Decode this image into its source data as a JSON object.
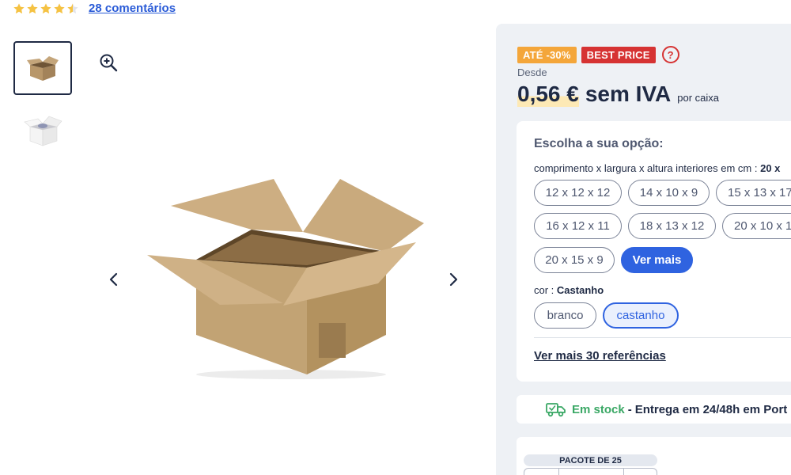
{
  "rating": {
    "stars": 4.5,
    "comments_link": "28 comentários",
    "star_color": "#f5c243"
  },
  "gallery": {
    "thumbnails": [
      "box-thumbnail",
      "white-box-thumbnail"
    ],
    "active_index": 0
  },
  "badges": {
    "discount": "ATÉ -30%",
    "best_price": "BEST PRICE",
    "help": "?"
  },
  "price": {
    "prefix": "Desde",
    "amount": "0,56 €",
    "tax": "sem IVA",
    "unit": "por caixa"
  },
  "options": {
    "title": "Escolha a sua opção:",
    "dimension_label": "comprimento x largura x altura interiores em cm :",
    "dimension_selected": "20 x",
    "dimensions": [
      "12 x 12 x 12",
      "14 x 10 x 9",
      "15 x 13 x 17",
      "16 x 12 x 11",
      "18 x 13 x 12",
      "20 x 10 x 1",
      "20 x 15 x 9"
    ],
    "see_more": "Ver mais",
    "color_label": "cor :",
    "color_selected": "Castanho",
    "colors": [
      "branco",
      "castanho"
    ],
    "more_references": "Ver mais 30 referências"
  },
  "stock": {
    "status": "Em stock",
    "separator": "-",
    "delivery": "Entrega em 24/48h em Port"
  },
  "buy": {
    "pack_label": "PACOTE DE 25"
  },
  "colors": {
    "link_blue": "#2a5bd7",
    "primary_blue": "#2f63e0",
    "stock_green": "#3aa865",
    "discount_orange": "#f4a63a",
    "best_price_red": "#d63333",
    "panel_bg": "#eef1f5"
  }
}
